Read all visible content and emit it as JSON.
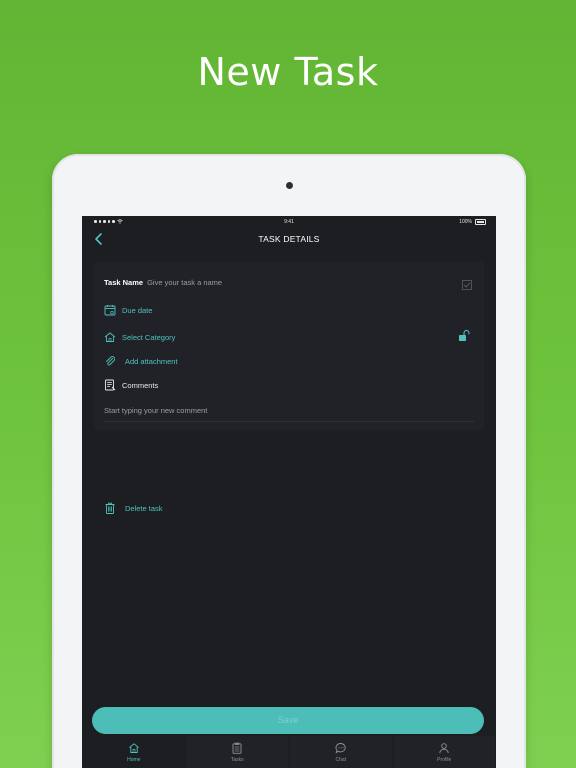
{
  "marketing": {
    "headline": "New Task"
  },
  "status_bar": {
    "time": "9:41",
    "battery": "100%"
  },
  "nav": {
    "title": "TASK DETAILS"
  },
  "form": {
    "task_name_label": "Task Name",
    "task_name_placeholder": "Give your task a name",
    "due_date": "Due date",
    "category": "Select Category",
    "attachment": "Add attachment",
    "comments_label": "Comments",
    "comment_placeholder": "Start typing your new comment"
  },
  "actions": {
    "delete": "Delete task",
    "save": "Save"
  },
  "tabs": [
    {
      "label": "Home",
      "icon": "home-icon"
    },
    {
      "label": "Tasks",
      "icon": "clipboard-icon"
    },
    {
      "label": "Chat",
      "icon": "chat-bubble-icon"
    },
    {
      "label": "Profile",
      "icon": "user-icon"
    }
  ],
  "colors": {
    "accent": "#4fc3bd",
    "background": "#1c1e22",
    "brand_green": "#6fc43d"
  }
}
